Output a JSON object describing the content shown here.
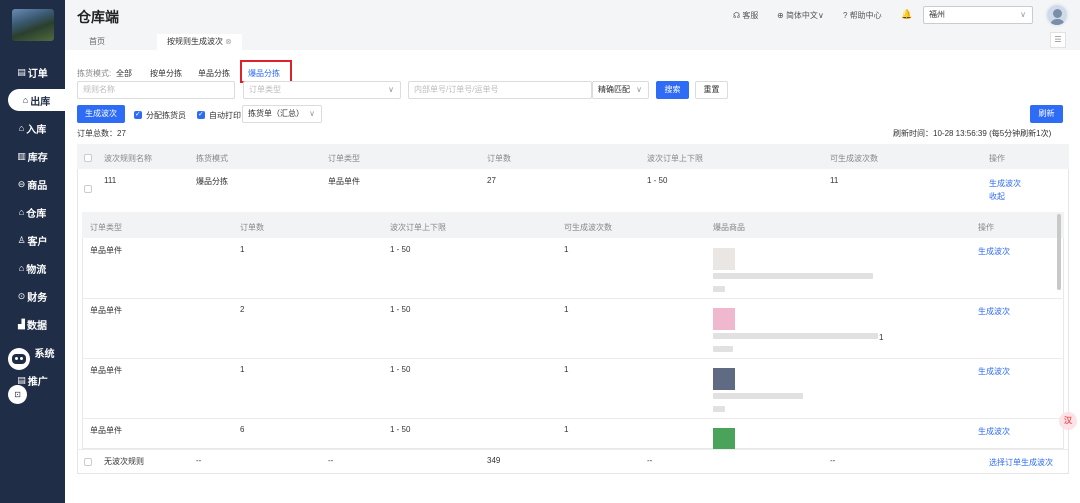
{
  "app": {
    "title": "仓库端"
  },
  "sidebar": {
    "items": [
      {
        "label": "订单",
        "icon": "orders-icon",
        "glyph": "▤"
      },
      {
        "label": "出库",
        "icon": "outbound-icon",
        "glyph": "⌂"
      },
      {
        "label": "入库",
        "icon": "inbound-icon",
        "glyph": "⌂"
      },
      {
        "label": "库存",
        "icon": "inventory-icon",
        "glyph": "▥"
      },
      {
        "label": "商品",
        "icon": "goods-icon",
        "glyph": "⊖"
      },
      {
        "label": "仓库",
        "icon": "warehouse-icon",
        "glyph": "⌂"
      },
      {
        "label": "客户",
        "icon": "customer-icon",
        "glyph": "♙"
      },
      {
        "label": "物流",
        "icon": "logistics-icon",
        "glyph": "⌂"
      },
      {
        "label": "财务",
        "icon": "finance-icon",
        "glyph": "⊙"
      },
      {
        "label": "数据",
        "icon": "data-icon",
        "glyph": "▟"
      },
      {
        "label": "系统",
        "icon": "system-icon",
        "glyph": ""
      },
      {
        "label": "推广",
        "icon": "promotion-icon",
        "glyph": "▤"
      }
    ],
    "small_button": "⊡"
  },
  "header": {
    "service": "客服",
    "language": "简体中文",
    "help": "帮助中心",
    "warehouse": "福州"
  },
  "tabs": [
    {
      "label": "首页"
    },
    {
      "label": "按规则生成波次",
      "close": "⊗"
    }
  ],
  "tab_menu_glyph": "☰",
  "filters": {
    "mode_label": "拣货模式:",
    "modes": [
      "全部",
      "按单分拣",
      "单品分拣",
      "爆品分拣"
    ],
    "rule_name_placeholder": "规则名称",
    "order_type_placeholder": "订单类型",
    "order_no_placeholder": "内部单号/订单号/运单号",
    "match_mode": "精确匹配",
    "search_label": "搜索",
    "reset_label": "重置"
  },
  "toolbar": {
    "generate_label": "生成波次",
    "assign_picker": "分配拣货员",
    "auto_print": "自动打印",
    "print_select": "拣货单（汇总）",
    "refresh_label": "刷新",
    "total_orders": "订单总数：27",
    "refresh_time_label": "刷新时间：",
    "refresh_time": "10-28 13:56:39",
    "refresh_note": "(每5分钟刷新1次)"
  },
  "table": {
    "columns": [
      "波次规则名称",
      "拣货模式",
      "订单类型",
      "订单数",
      "波次订单上下限",
      "可生成波次数",
      "操作"
    ],
    "rows": [
      {
        "name": "111",
        "mode": "爆品分拣",
        "type": "单品单件",
        "count": "27",
        "range": "1 - 50",
        "waves": "11",
        "action1": "生成波次",
        "action2": "收起"
      },
      {
        "name": "无波次规则",
        "mode": "--",
        "type": "--",
        "count": "349",
        "range": "--",
        "waves": "--",
        "action1": "选择订单生成波次"
      }
    ]
  },
  "subtable": {
    "columns": [
      "订单类型",
      "订单数",
      "波次订单上下限",
      "可生成波次数",
      "爆品商品",
      "操作"
    ],
    "rows": [
      {
        "type": "单品单件",
        "count": "1",
        "range": "1 - 50",
        "waves": "1",
        "action": "生成波次",
        "img": "#e9e6e4"
      },
      {
        "type": "单品单件",
        "count": "2",
        "range": "1 - 50",
        "waves": "1",
        "action": "生成波次",
        "img": "#f0b8cf",
        "suffix": "1"
      },
      {
        "type": "单品单件",
        "count": "1",
        "range": "1 - 50",
        "waves": "1",
        "action": "生成波次",
        "img": "#5e6b83"
      },
      {
        "type": "单品单件",
        "count": "6",
        "range": "1 - 50",
        "waves": "1",
        "action": "生成波次",
        "img": "#4aa35a"
      }
    ]
  },
  "float_tag": "汉"
}
